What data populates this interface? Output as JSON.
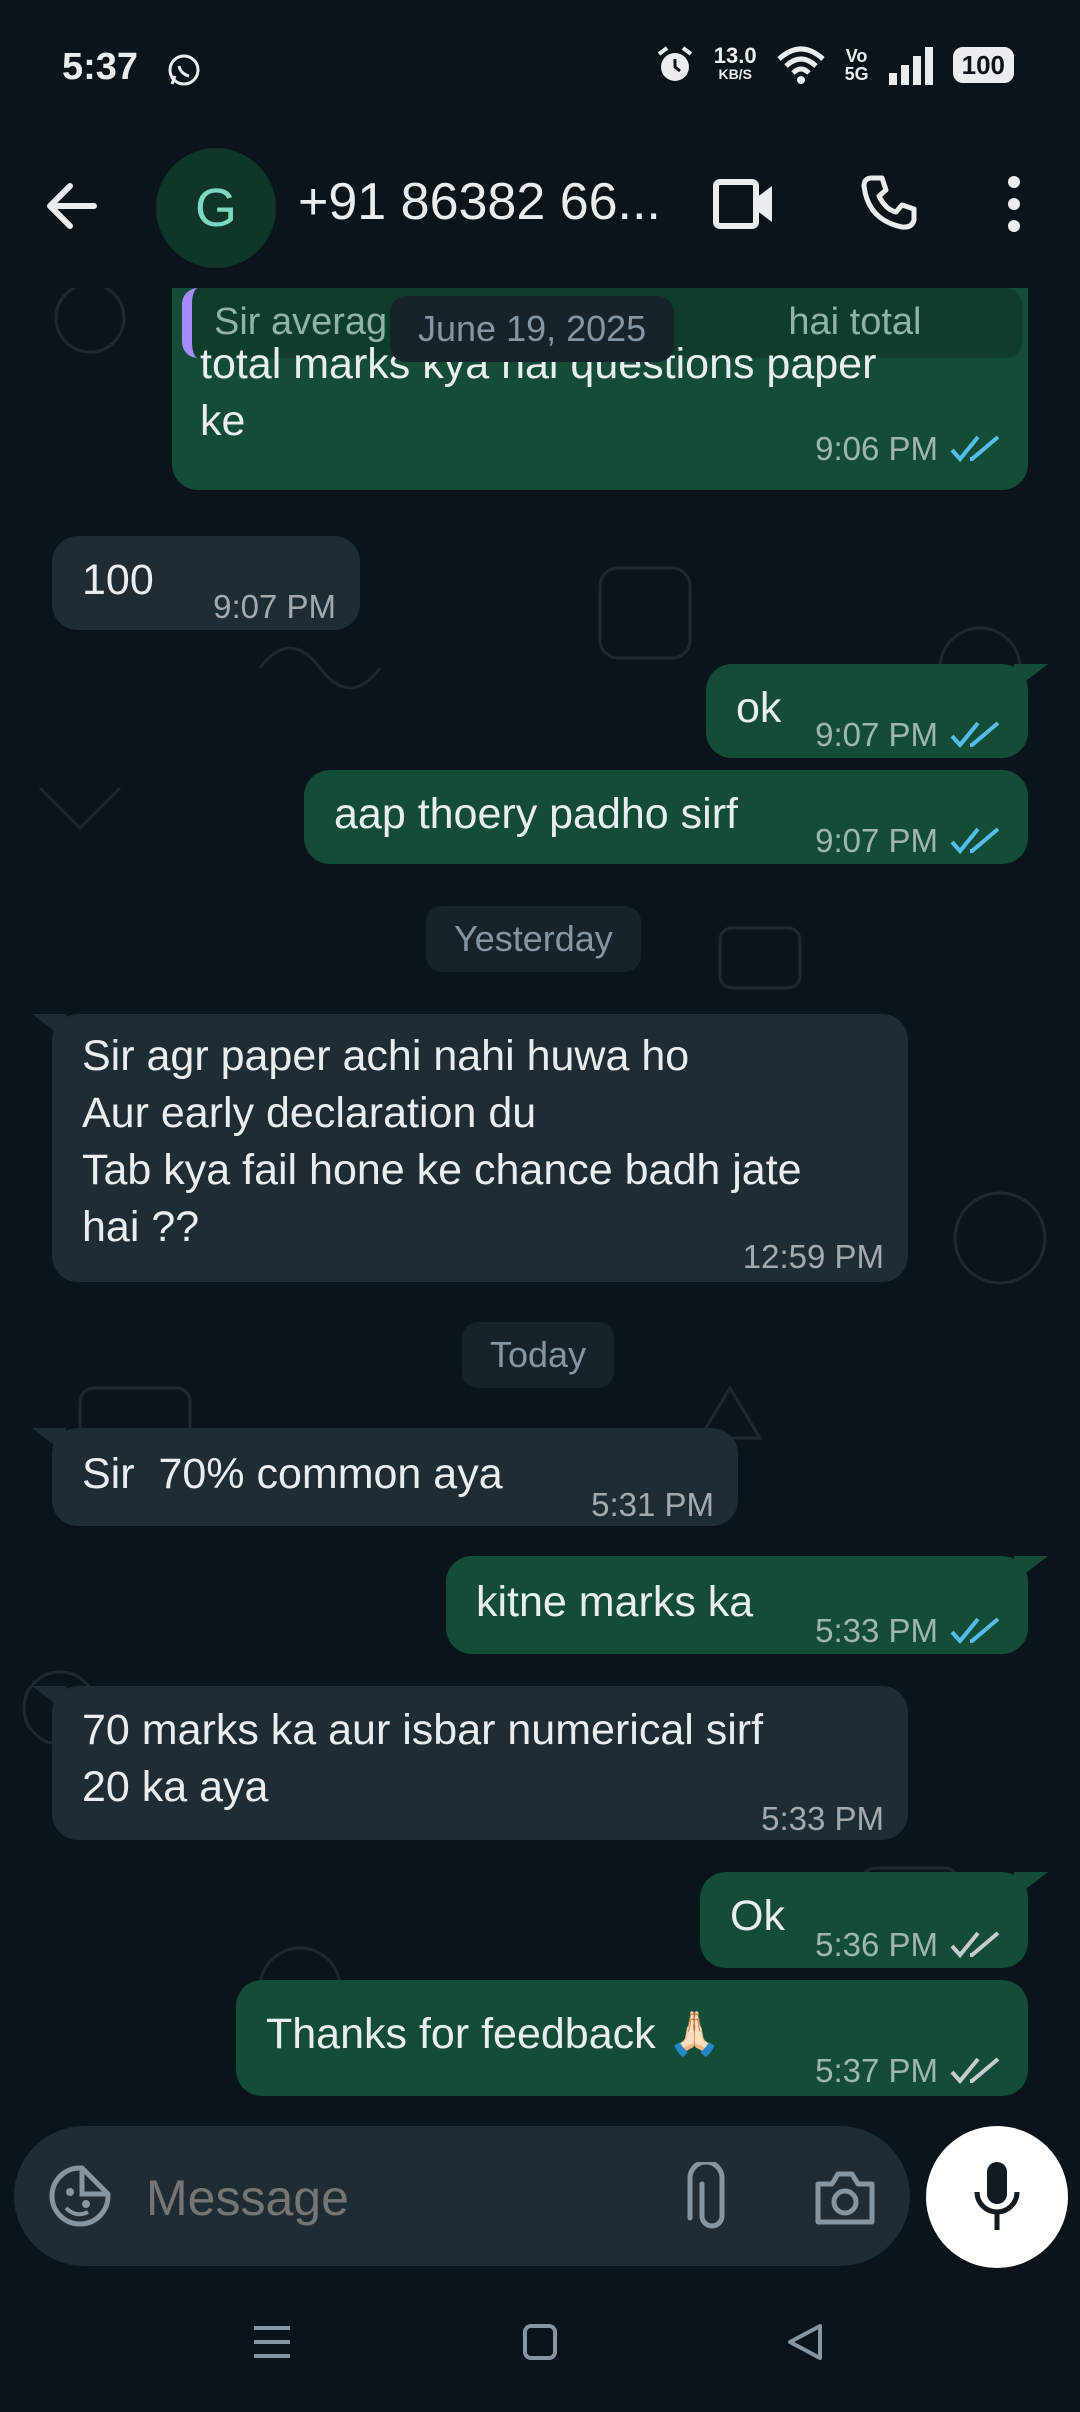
{
  "status_bar": {
    "time": "5:37",
    "net_speed_value": "13.0",
    "net_speed_unit": "KB/S",
    "volte_top": "Vo",
    "volte_bottom": "5G",
    "battery": "100"
  },
  "header": {
    "avatar_initial": "G",
    "contact_name": "+91 86382 66..."
  },
  "chat": {
    "quoted_reply": "Sir averag                                      hai total",
    "date_chips": [
      "June 19, 2025",
      "Yesterday",
      "Today"
    ],
    "messages": [
      {
        "dir": "out",
        "text": "total marks kya hai questions paper\nke",
        "time": "9:06 PM"
      },
      {
        "dir": "in",
        "text": "100",
        "time": "9:07 PM"
      },
      {
        "dir": "out",
        "text": "ok",
        "time": "9:07 PM"
      },
      {
        "dir": "out",
        "text": "aap thoery padho sirf",
        "time": "9:07 PM"
      },
      {
        "dir": "in",
        "text": "Sir agr paper achi nahi huwa ho\nAur early declaration du\nTab kya fail hone ke chance badh jate\nhai ??",
        "time": "12:59 PM"
      },
      {
        "dir": "in",
        "text": "Sir  70% common aya",
        "time": "5:31 PM"
      },
      {
        "dir": "out",
        "text": "kitne marks ka",
        "time": "5:33 PM"
      },
      {
        "dir": "in",
        "text": "70 marks ka aur isbar numerical sirf\n20 ka aya",
        "time": "5:33 PM"
      },
      {
        "dir": "out",
        "text": "Ok",
        "time": "5:36 PM"
      },
      {
        "dir": "out",
        "text": "Thanks for feedback 🙏🏻",
        "time": "5:37 PM"
      }
    ]
  },
  "input": {
    "placeholder": "Message"
  },
  "colors": {
    "background": "#0b141a",
    "outgoing_bubble": "#144d37",
    "incoming_bubble": "#202c33",
    "read_tick": "#53bdeb",
    "delivered_tick": "#c5cbce"
  },
  "icons": [
    "whatsapp-status-icon",
    "alarm-icon",
    "wifi-icon",
    "signal-icon",
    "back-arrow-icon",
    "video-call-icon",
    "voice-call-icon",
    "more-options-icon",
    "emoji-sticker-icon",
    "attach-icon",
    "camera-icon",
    "mic-icon",
    "nav-menu-icon",
    "nav-home-icon",
    "nav-back-icon"
  ]
}
